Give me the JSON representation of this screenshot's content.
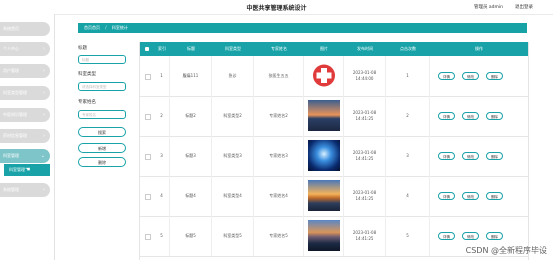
{
  "header": {
    "title": "中医共享管理系统设计",
    "user_label": "管理员 admin",
    "logout_label": "退出登录"
  },
  "sidebar": {
    "items": [
      {
        "label": "系统首页"
      },
      {
        "label": "个人中心"
      },
      {
        "label": "用户管理"
      },
      {
        "label": "科室类型管理"
      },
      {
        "label": "中医知识管理"
      },
      {
        "label": "药材信息管理"
      },
      {
        "label": "科室管理"
      },
      {
        "label": "系统管理"
      }
    ],
    "submenu": {
      "label": "科室管理"
    }
  },
  "breadcrumb": {
    "home": "首页首页",
    "current": "科室统计"
  },
  "search": {
    "fields": [
      {
        "label": "标题",
        "placeholder": "标题"
      },
      {
        "label": "科室类型",
        "placeholder": "请选择科室类型"
      },
      {
        "label": "专家姓名",
        "placeholder": "专家姓名"
      }
    ],
    "buttons": {
      "search": "搜索",
      "add": "新增",
      "delete": "删除"
    }
  },
  "table": {
    "headers": [
      "索引",
      "标题",
      "科室类型",
      "专家姓名",
      "图片",
      "发布时间",
      "点击次数",
      "操作"
    ],
    "rows": [
      {
        "index": "1",
        "title": "腹痛111",
        "type": "急诊",
        "expert": "张医生五五",
        "time": "2023-01-08 14:44:00",
        "clicks": "1",
        "image": "red-cross"
      },
      {
        "index": "2",
        "title": "标题2",
        "type": "科室类型2",
        "expert": "专家姓名2",
        "time": "2023-01-08 14:41:25",
        "clicks": "2",
        "image": "lake-sunset"
      },
      {
        "index": "3",
        "title": "标题3",
        "type": "科室类型3",
        "expert": "专家姓名3",
        "time": "2023-01-08 14:41:25",
        "clicks": "3",
        "image": "blue-burst"
      },
      {
        "index": "4",
        "title": "标题4",
        "type": "科室类型4",
        "expert": "专家姓名4",
        "time": "2023-01-08 14:41:25",
        "clicks": "4",
        "image": "sky-sunset"
      },
      {
        "index": "5",
        "title": "标题5",
        "type": "科室类型5",
        "expert": "专家姓名5",
        "time": "2023-01-08 14:41:25",
        "clicks": "5",
        "image": "dusk-lake"
      }
    ],
    "actions": {
      "detail": "详情",
      "edit": "修改",
      "delete": "删除"
    }
  },
  "watermark": "CSDN @全新程序毕设",
  "colors": {
    "primary": "#19a3a8",
    "menu": "#dadada",
    "menu_active": "#7ec5c9"
  }
}
